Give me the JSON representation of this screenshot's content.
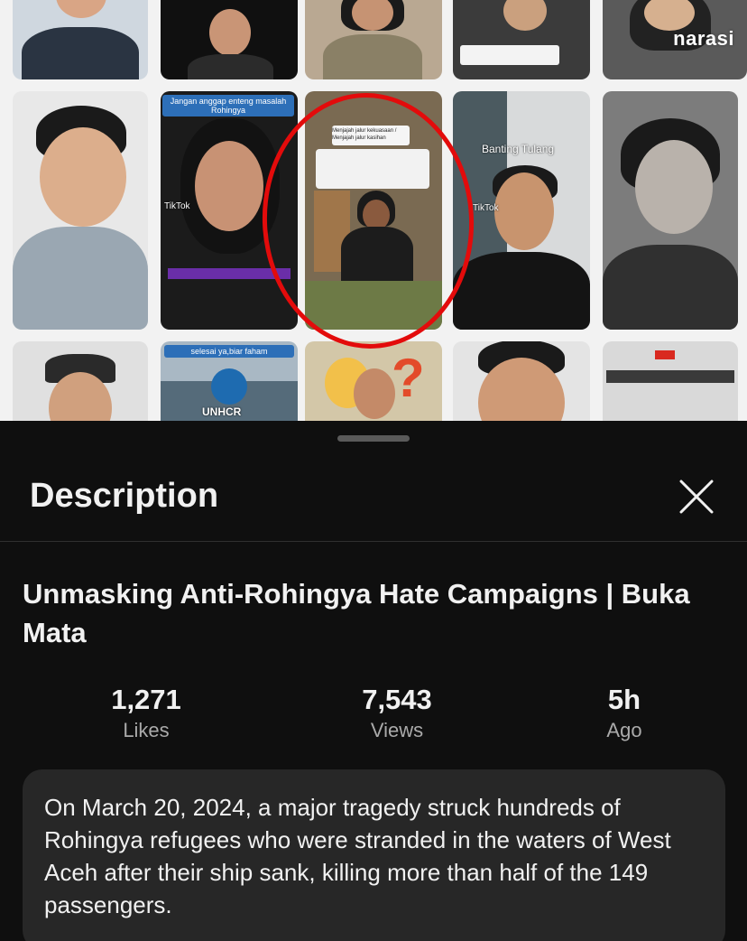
{
  "video": {
    "watermark": "narasi",
    "captions": {
      "tile_pink_title": "Jangan anggap enteng masalah Rohingya",
      "tile_banting": "Banting Tulang",
      "tile_unhcr_top": "selesai ya,biar faham",
      "tile_unhcr_logo": "UNHCR",
      "tiktok_1": "TikTok",
      "tiktok_2": "TikTok",
      "menjajah": "Menjajah jalur kekuasaan / Menjajah jalur kasihan"
    }
  },
  "sheet": {
    "title": "Description",
    "close_icon": "close-icon"
  },
  "video_info": {
    "title": "Unmasking Anti-Rohingya Hate Campaigns | Buka Mata",
    "stats": [
      {
        "value": "1,271",
        "label": "Likes"
      },
      {
        "value": "7,543",
        "label": "Views"
      },
      {
        "value": "5h",
        "label": "Ago"
      }
    ],
    "description": "On March 20, 2024, a major tragedy struck hundreds of Rohingya refugees who were stranded in the waters of West Aceh after their ship sank, killing more than half of the 149 passengers."
  },
  "colors": {
    "background": "#0f0f0f",
    "card": "#272727",
    "highlight_circle": "#e30b0b"
  }
}
